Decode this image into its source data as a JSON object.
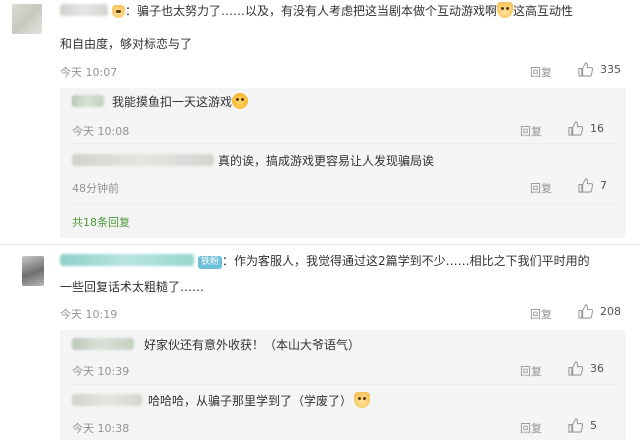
{
  "comments": [
    {
      "text_line1": "：骗子也太努力了……以及，有没有人考虑把这当剧本做个互动游戏啊",
      "text_line1_tail": "这高互动性",
      "text_line2": "和自由度，够对标恋与了",
      "time": "今天 10:07",
      "reply_label": "回复",
      "likes": "335",
      "replies": [
        {
          "text": "我能摸鱼扣一天这游戏",
          "time": "今天 10:08",
          "reply_label": "回复",
          "likes": "16"
        },
        {
          "text": "真的诶，搞成游戏更容易让人发现骗局诶",
          "time": "48分钟前",
          "reply_label": "回复",
          "likes": "7"
        }
      ],
      "more": "共18条回复"
    },
    {
      "badge": "铁粉",
      "text_line1": "：作为客服人，我觉得通过这2篇学到不少……相比之下我们平时用的",
      "text_line2": "一些回复话术太粗糙了……",
      "time": "今天 10:19",
      "reply_label": "回复",
      "likes": "208",
      "replies": [
        {
          "text": "好家伙还有意外收获！（本山大爷语气）",
          "time": "今天 10:39",
          "reply_label": "回复",
          "likes": "36"
        },
        {
          "text": "哈哈哈，从骗子那里学到了（学废了）",
          "time": "今天 10:38",
          "reply_label": "回复",
          "likes": "5"
        }
      ]
    }
  ],
  "icons": {
    "like": "thumbs-up-icon"
  },
  "colors": {
    "more_link": "#4f9a3d",
    "meta": "#939393",
    "badge": "#6fc0d9"
  }
}
